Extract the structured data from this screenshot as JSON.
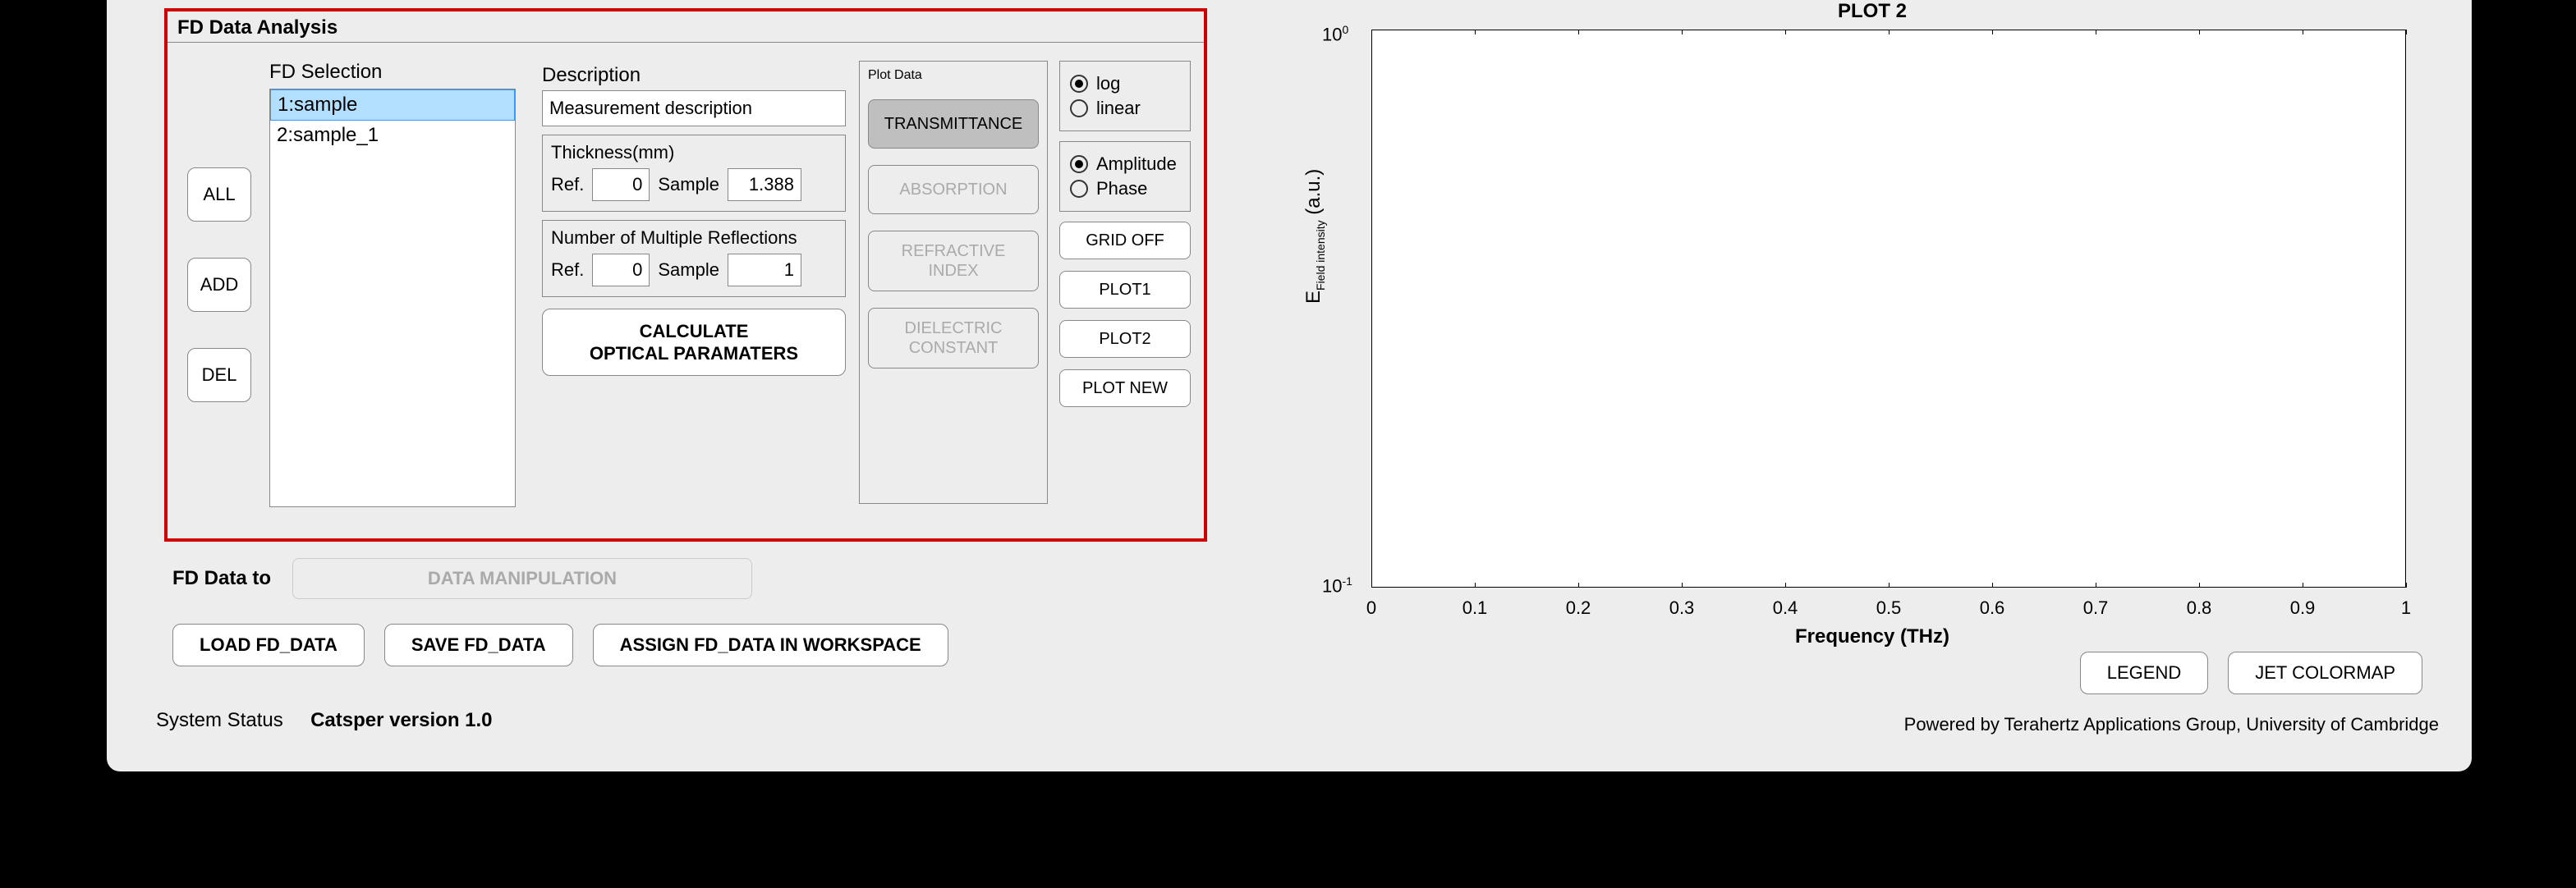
{
  "panel": {
    "title": "FD Data Analysis",
    "selection_label": "FD Selection",
    "items": [
      "1:sample",
      "2:sample_1"
    ],
    "selected_index": 0,
    "btn_all": "ALL",
    "btn_add": "ADD",
    "btn_del": "DEL"
  },
  "props": {
    "desc_label": "Description",
    "desc_value": "Measurement description",
    "thickness": {
      "title": "Thickness(mm)",
      "ref_label": "Ref.",
      "ref_value": "0",
      "sample_label": "Sample",
      "sample_value": "1.388"
    },
    "reflections": {
      "title": "Number of Multiple Reflections",
      "ref_label": "Ref.",
      "ref_value": "0",
      "sample_label": "Sample",
      "sample_value": "1"
    },
    "calc_label": "CALCULATE\nOPTICAL PARAMATERS"
  },
  "plotdata": {
    "title": "Plot Data",
    "transmittance": "TRANSMITTANCE",
    "absorption": "ABSORPTION",
    "refractive": "REFRACTIVE\nINDEX",
    "dielectric": "DIELECTRIC\nCONSTANT"
  },
  "controls": {
    "scale": {
      "log": "log",
      "linear": "linear",
      "selected": "log"
    },
    "mode": {
      "amplitude": "Amplitude",
      "phase": "Phase",
      "selected": "amplitude"
    },
    "grid": "GRID OFF",
    "plot1": "PLOT1",
    "plot2": "PLOT2",
    "plotnew": "PLOT NEW"
  },
  "below": {
    "fd_to_label": "FD Data to",
    "data_manip": "DATA MANIPULATION",
    "load": "LOAD FD_DATA",
    "save": "SAVE FD_DATA",
    "assign": "ASSIGN FD_DATA IN WORKSPACE"
  },
  "status": {
    "label": "System Status",
    "version": "Catsper version 1.0",
    "credit": "Powered by Terahertz Applications Group, University of Cambridge"
  },
  "plot": {
    "title": "PLOT 2",
    "ylabel_prefix": "E",
    "ylabel_sub": "Field intensity",
    "ylabel_suffix": " (a.u.)",
    "xlabel": "Frequency (THz)",
    "yticks": [
      "10^0",
      "10^-1"
    ],
    "xticks": [
      "0",
      "0.1",
      "0.2",
      "0.3",
      "0.4",
      "0.5",
      "0.6",
      "0.7",
      "0.8",
      "0.9",
      "1"
    ],
    "legend_btn": "LEGEND",
    "colormap_btn": "JET COLORMAP"
  },
  "chart_data": {
    "type": "line",
    "title": "PLOT 2",
    "xlabel": "Frequency (THz)",
    "ylabel": "E Field intensity (a.u.)",
    "xlim": [
      0,
      1
    ],
    "ylim": [
      0.1,
      1
    ],
    "yscale": "log",
    "x": [],
    "series": []
  }
}
